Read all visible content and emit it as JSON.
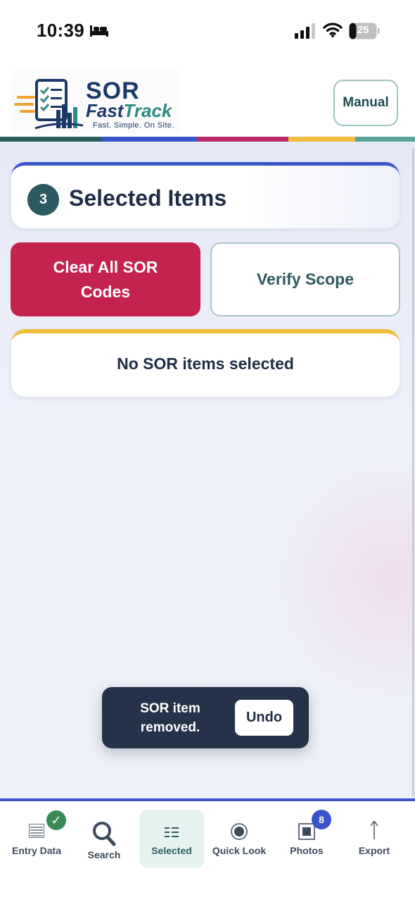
{
  "status_bar": {
    "time": "10:39",
    "battery": "25"
  },
  "header": {
    "logo": {
      "line1": "SOR",
      "line2a": "Fast",
      "line2b": "Track",
      "tagline": "Fast. Simple. On Site."
    },
    "manual_label": "Manual"
  },
  "colors": {
    "strip": [
      "#2c5e5e",
      "#3a55c9",
      "#3a55c9",
      "#b8286a",
      "#f0bd3e",
      "#5aa39a"
    ],
    "primary": "#3a55c9",
    "danger": "#c4234e",
    "teal": "#2d5a60",
    "amber": "#f0bd3e"
  },
  "main": {
    "selected_count": "3",
    "title": "Selected Items",
    "clear_label": "Clear All SOR Codes",
    "verify_label": "Verify Scope",
    "empty_message": "No SOR items selected"
  },
  "toast": {
    "message": "SOR item removed.",
    "action": "Undo"
  },
  "tabs": [
    {
      "label": "Entry Data",
      "icon": "list-icon",
      "badge": "✓"
    },
    {
      "label": "Search",
      "icon": "search-icon"
    },
    {
      "label": "Selected",
      "icon": "selected-list-icon",
      "active": true
    },
    {
      "label": "Quick Look",
      "icon": "radio-icon"
    },
    {
      "label": "Photos",
      "icon": "photo-icon",
      "badge": "8"
    },
    {
      "label": "Export",
      "icon": "upload-arrow-icon"
    }
  ]
}
